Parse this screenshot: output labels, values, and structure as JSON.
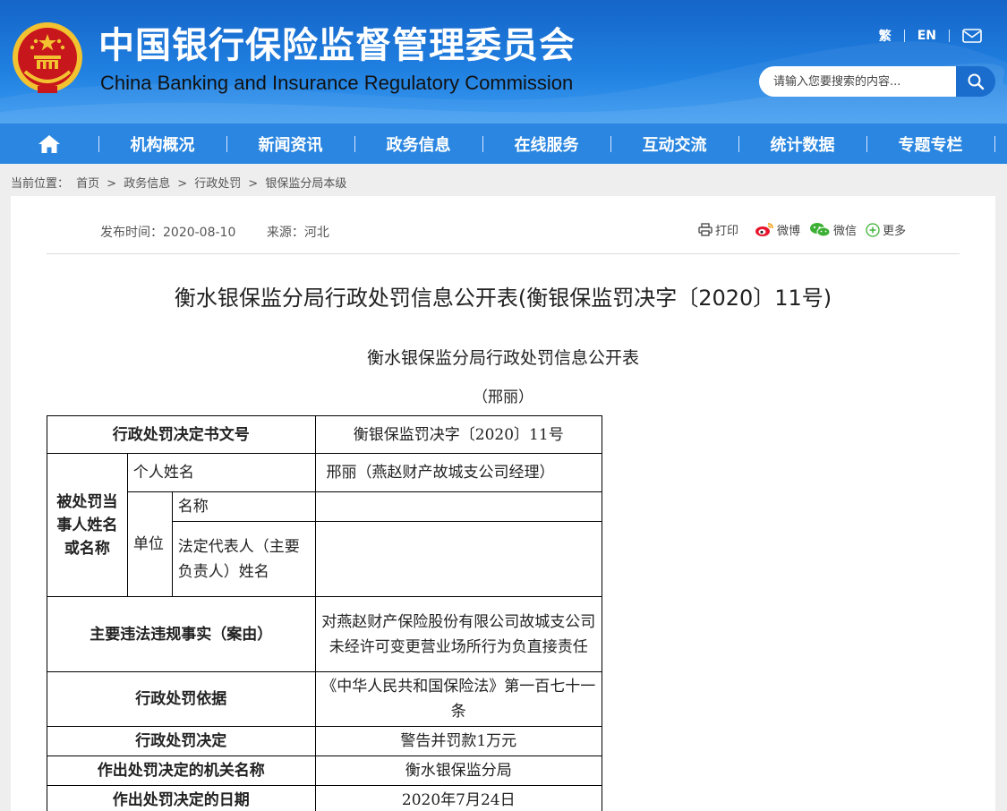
{
  "header": {
    "title_cn": "中国银行保险监督管理委员会",
    "title_en": "China Banking and Insurance Regulatory Commission",
    "lang_trad": "繁",
    "lang_en": "EN",
    "search_placeholder": "请输入您要搜索的内容...",
    "emblem_icon": "national-emblem-icon",
    "mail_icon": "mail-icon",
    "search_icon": "search-icon"
  },
  "nav": {
    "home_icon": "home-icon",
    "items": [
      "机构概况",
      "新闻资讯",
      "政务信息",
      "在线服务",
      "互动交流",
      "统计数据",
      "专题专栏"
    ]
  },
  "breadcrumb": {
    "label": "当前位置：",
    "items": [
      "首页",
      "政务信息",
      "行政处罚",
      "银保监分局本级"
    ]
  },
  "meta": {
    "publish": "发布时间：2020-08-10",
    "source": "来源：河北"
  },
  "share": {
    "print": "打印",
    "weibo": "微博",
    "wechat": "微信",
    "more": "更多"
  },
  "document": {
    "title": "衡水银保监分局行政处罚信息公开表(衡银保监罚决字〔2020〕11号)",
    "subtitle": "衡水银保监分局行政处罚信息公开表",
    "party": "（邢丽）"
  },
  "table": {
    "r1_label": "行政处罚决定书文号",
    "r1_value": "衡银保监罚决字〔2020〕11号",
    "party_label": "被处罚当事人姓名或名称",
    "person_label": "个人姓名",
    "person_value": "邢丽（燕赵财产故城支公司经理）",
    "unit_label": "单位",
    "unit_name_label": "名称",
    "unit_name_value": "",
    "legal_rep_label": "法定代表人（主要负责人）姓名",
    "legal_rep_value": "",
    "facts_label": "主要违法违规事实（案由）",
    "facts_value": "对燕赵财产保险股份有限公司故城支公司未经许可变更营业场所行为负直接责任",
    "basis_label": "行政处罚依据",
    "basis_value": "《中华人民共和国保险法》第一百七十一条",
    "decision_label": "行政处罚决定",
    "decision_value": "警告并罚款1万元",
    "authority_label": "作出处罚决定的机关名称",
    "authority_value": "衡水银保监分局",
    "date_label": "作出处罚决定的日期",
    "date_value": "2020年7月24日"
  },
  "colors": {
    "header_blue": "#1f7fe0",
    "nav_blue": "#2a86e0",
    "emblem_red": "#c8161d",
    "emblem_gold": "#f2c230"
  }
}
